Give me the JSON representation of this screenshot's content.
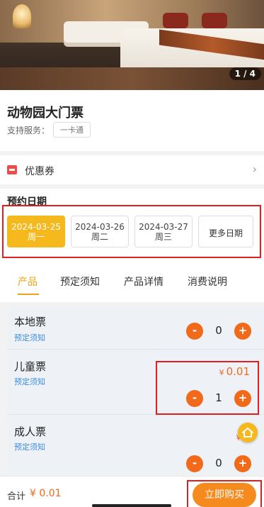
{
  "gallery": {
    "counter": "1 / 4"
  },
  "product": {
    "title": "动物园大门票",
    "support_label": "支持服务：",
    "support_tag": "一卡通"
  },
  "coupon": {
    "label": "优惠券",
    "arrow": "›"
  },
  "booking": {
    "title": "预约日期",
    "dates": [
      {
        "date": "2024-03-25",
        "weekday": "周一",
        "selected": true
      },
      {
        "date": "2024-03-26",
        "weekday": "周二",
        "selected": false
      },
      {
        "date": "2024-03-27",
        "weekday": "周三",
        "selected": false
      }
    ],
    "more_label": "更多日期"
  },
  "tabs": [
    {
      "label": "产品",
      "active": true
    },
    {
      "label": "预定须知",
      "active": false
    },
    {
      "label": "产品详情",
      "active": false
    },
    {
      "label": "消费说明",
      "active": false
    }
  ],
  "tickets": [
    {
      "name": "本地票",
      "note": "预定须知",
      "price": "",
      "currency": "",
      "quantity": "0"
    },
    {
      "name": "儿童票",
      "note": "预定须知",
      "price": "0.01",
      "currency": "¥",
      "quantity": "1"
    },
    {
      "name": "成人票",
      "note": "预定须知",
      "price": "1",
      "currency": "¥",
      "quantity": "0"
    }
  ],
  "stepper": {
    "minus": "-",
    "plus": "+"
  },
  "footer": {
    "total_label": "合计",
    "total_value": "¥ 0.01",
    "buy_label": "立即购买"
  },
  "colors": {
    "accent": "#f5b81d",
    "orange": "#f06a1a",
    "highlight_box": "#e02020",
    "link": "#3c8ee6"
  }
}
